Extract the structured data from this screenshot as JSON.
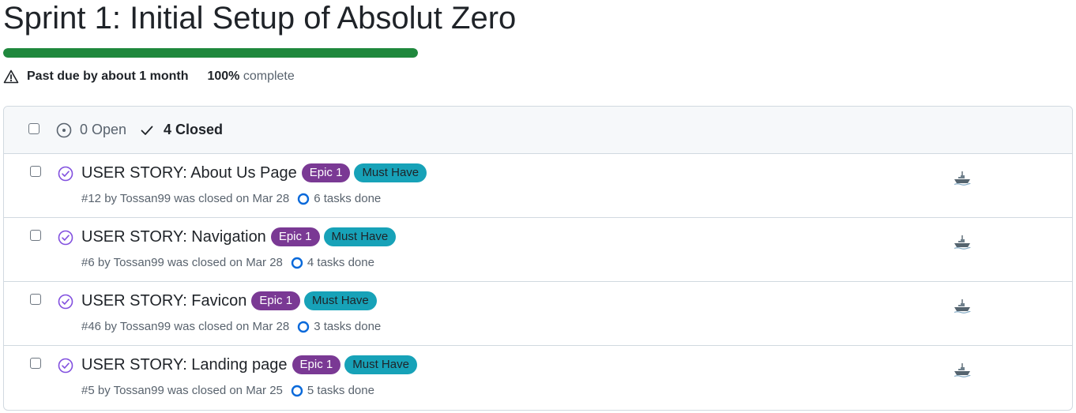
{
  "milestone": {
    "title": "Sprint 1: Initial Setup of Absolut Zero",
    "progress_percent": 100,
    "due_status": "Past due by about 1 month",
    "complete_value": "100%",
    "complete_label": "complete",
    "progress_color": "#1f883d"
  },
  "header": {
    "open_label": "0 Open",
    "closed_label": "4 Closed"
  },
  "issues": [
    {
      "title": "USER STORY: About Us Page",
      "labels": [
        "Epic 1",
        "Must Have"
      ],
      "meta": "#12 by Tossan99 was closed on Mar 28",
      "tasks": "6 tasks done"
    },
    {
      "title": "USER STORY: Navigation",
      "labels": [
        "Epic 1",
        "Must Have"
      ],
      "meta": "#6 by Tossan99 was closed on Mar 28",
      "tasks": "4 tasks done"
    },
    {
      "title": "USER STORY: Favicon",
      "labels": [
        "Epic 1",
        "Must Have"
      ],
      "meta": "#46 by Tossan99 was closed on Mar 28",
      "tasks": "3 tasks done"
    },
    {
      "title": "USER STORY: Landing page",
      "labels": [
        "Epic 1",
        "Must Have"
      ],
      "meta": "#5 by Tossan99 was closed on Mar 25",
      "tasks": "5 tasks done"
    }
  ],
  "colors": {
    "epic_label": "#7a3994",
    "must_have_label": "#17a2b8",
    "closed_icon": "#8250df"
  },
  "icons": {
    "warning": "alert-icon",
    "open": "issue-opened-icon",
    "closed": "check-icon",
    "issue_state": "issue-closed-icon",
    "tasks": "circle-progress-icon",
    "assignee": "ship-icon"
  }
}
